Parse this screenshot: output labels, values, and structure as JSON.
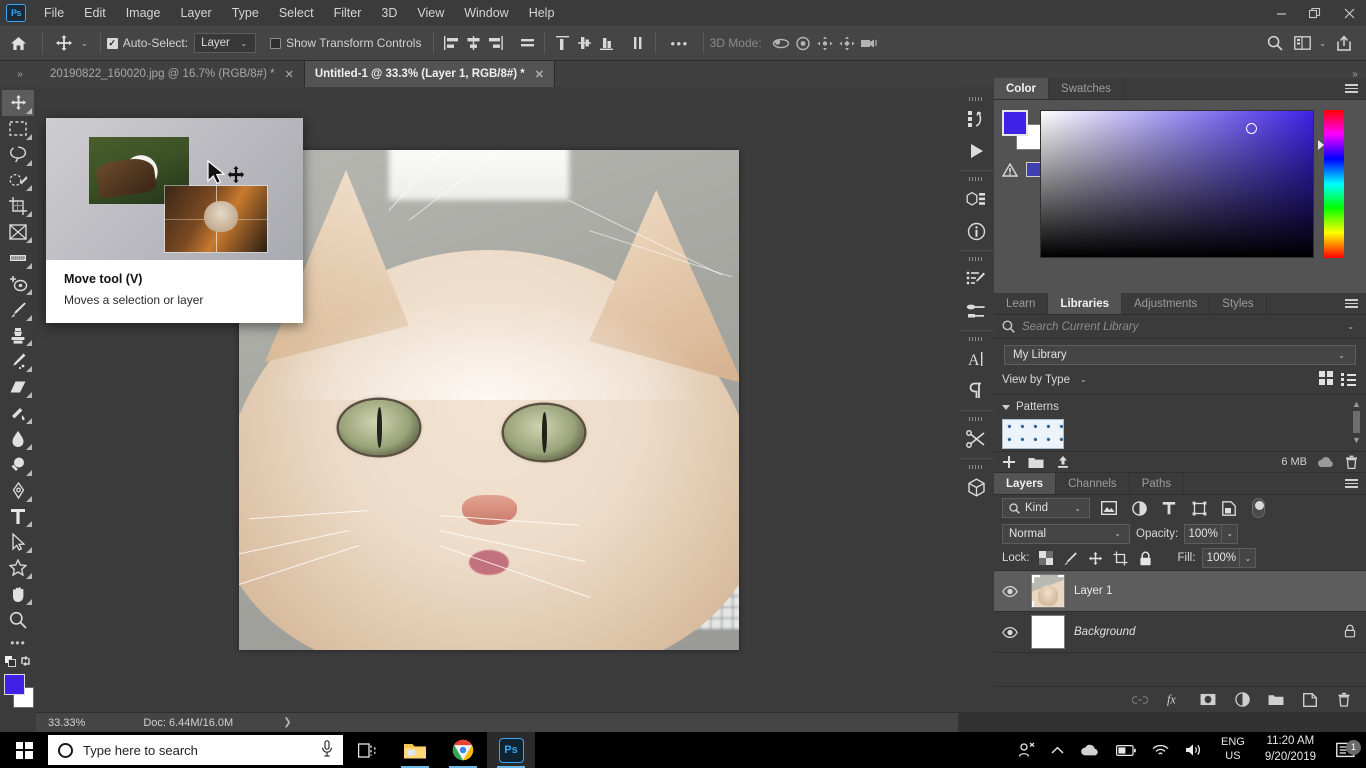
{
  "app": {
    "logo": "Ps",
    "title": "Adobe Photoshop"
  },
  "menubar": {
    "items": [
      "File",
      "Edit",
      "Image",
      "Layer",
      "Type",
      "Select",
      "Filter",
      "3D",
      "View",
      "Window",
      "Help"
    ],
    "window_controls": {
      "minimize": "—",
      "restore": "❐",
      "close": "✕"
    }
  },
  "options_bar": {
    "home_icon": "home-icon",
    "tool_icon": "move-tool-icon",
    "auto_select_label": "Auto-Select:",
    "auto_select_checked": true,
    "auto_select_value": "Layer",
    "show_transform_label": "Show Transform Controls",
    "show_transform_checked": false,
    "more_options": "•••",
    "mode_3d_label": "3D Mode:",
    "align_icons": [
      "align-left-edges",
      "align-horizontal-centers",
      "align-right-edges",
      "distribute-horizontal"
    ],
    "align_icons_2": [
      "align-top-edges",
      "align-vertical-centers",
      "align-bottom-edges",
      "distribute-vertical"
    ],
    "icons_3d": [
      "orbit-3d-icon",
      "roll-3d-icon",
      "pan-3d-icon",
      "slide-3d-icon",
      "camera-3d-icon"
    ],
    "right_icons": [
      "search-icon",
      "workspace-icon",
      "chevron-down-icon",
      "share-icon"
    ]
  },
  "tabs": {
    "collapse_icon": "»",
    "items": [
      {
        "label": "20190822_160020.jpg @ 16.7% (RGB/8#) *",
        "active": false,
        "close": "✕"
      },
      {
        "label": "Untitled-1 @ 33.3% (Layer 1, RGB/8#) *",
        "active": true,
        "close": "✕"
      }
    ],
    "expand_icon": "»"
  },
  "toolbar": {
    "tools": [
      {
        "name": "move-tool",
        "glyph": "✥",
        "selected": true
      },
      {
        "name": "rectangular-marquee-tool",
        "glyph": "▭",
        "selected": false
      },
      {
        "name": "lasso-tool",
        "glyph": "◯",
        "selected": false
      },
      {
        "name": "object-selection-tool",
        "glyph": "✦",
        "selected": false
      },
      {
        "name": "crop-tool",
        "glyph": "⌗",
        "selected": false
      },
      {
        "name": "frame-tool",
        "glyph": "⊠",
        "selected": false
      },
      {
        "name": "eyedropper-tool",
        "glyph": "▨",
        "selected": false
      },
      {
        "name": "spot-healing-brush-tool",
        "glyph": "✜",
        "selected": false
      },
      {
        "name": "brush-tool",
        "glyph": "✎",
        "selected": false
      },
      {
        "name": "clone-stamp-tool",
        "glyph": "⬗",
        "selected": false
      },
      {
        "name": "history-brush-tool",
        "glyph": "✐",
        "selected": false
      },
      {
        "name": "eraser-tool",
        "glyph": "◣",
        "selected": false
      },
      {
        "name": "gradient-tool",
        "glyph": "◨",
        "selected": false
      },
      {
        "name": "blur-tool",
        "glyph": "💧",
        "selected": false
      },
      {
        "name": "dodge-tool",
        "glyph": "🔍",
        "selected": false
      },
      {
        "name": "pen-tool",
        "glyph": "✒",
        "selected": false
      },
      {
        "name": "horizontal-type-tool",
        "glyph": "T",
        "selected": false
      },
      {
        "name": "path-selection-tool",
        "glyph": "➤",
        "selected": false
      },
      {
        "name": "custom-shape-tool",
        "glyph": "✧",
        "selected": false
      },
      {
        "name": "hand-tool",
        "glyph": "✋",
        "selected": false
      },
      {
        "name": "zoom-tool",
        "glyph": "🔎",
        "selected": false
      }
    ],
    "edit_toolbar": "•••",
    "foreground_color": "#3f22e6",
    "background_color": "#ffffff"
  },
  "canvas": {
    "document_label": "Untitled-1",
    "image_alt": "close-up photo of a cream tabby cat"
  },
  "tooltip": {
    "title": "Move tool (V)",
    "description": "Moves a selection or layer",
    "cursor_icon": "move-cursor-icon"
  },
  "statusbar": {
    "zoom": "33.33%",
    "doc": "Doc: 6.44M/16.0M",
    "arrow": "❯"
  },
  "rail": {
    "groups": [
      [
        "history-icon",
        "play-icon"
      ],
      [
        "3d-panel-icon",
        "info-icon"
      ],
      [
        "brush-settings-icon",
        "brush-presets-icon"
      ],
      [
        "character-panel-icon",
        "paragraph-panel-icon"
      ],
      [
        "tools-icon"
      ],
      [
        "3d-object-icon"
      ]
    ]
  },
  "color_panel": {
    "tabs": [
      {
        "label": "Color",
        "active": true
      },
      {
        "label": "Swatches",
        "active": false
      }
    ],
    "menu_icon": "panel-menu-icon",
    "foreground": "#3f22e6",
    "background": "#ffffff",
    "out_of_gamut_icon": "gamut-warning-icon",
    "gamut_swatch": "#3f3fb0"
  },
  "libraries_panel": {
    "tabs": [
      {
        "label": "Learn",
        "active": false
      },
      {
        "label": "Libraries",
        "active": true
      },
      {
        "label": "Adjustments",
        "active": false
      },
      {
        "label": "Styles",
        "active": false
      }
    ],
    "menu_icon": "panel-menu-icon",
    "search_placeholder": "Search Current Library",
    "search_value": "",
    "library_name": "My Library",
    "view_label": "View by Type",
    "group_label": "Patterns",
    "size_label": "6 MB",
    "footer_icons": [
      "add-icon",
      "new-group-icon",
      "upload-icon",
      "cloud-icon",
      "delete-icon"
    ]
  },
  "layers_panel": {
    "tabs": [
      {
        "label": "Layers",
        "active": true
      },
      {
        "label": "Channels",
        "active": false
      },
      {
        "label": "Paths",
        "active": false
      }
    ],
    "menu_icon": "panel-menu-icon",
    "filter_kind": "Kind",
    "filter_icons": [
      "pixel-filter-icon",
      "adjustment-filter-icon",
      "type-filter-icon",
      "shape-filter-icon",
      "smart-object-filter-icon"
    ],
    "blend_mode": "Normal",
    "opacity_label": "Opacity:",
    "opacity_value": "100%",
    "lock_label": "Lock:",
    "lock_icons": [
      "lock-transparent-pixels-icon",
      "lock-image-pixels-icon",
      "lock-position-icon",
      "lock-artboard-icon",
      "lock-all-icon"
    ],
    "fill_label": "Fill:",
    "fill_value": "100%",
    "layers": [
      {
        "name": "Layer 1",
        "visible": true,
        "selected": true,
        "italic": false,
        "locked": false,
        "thumb": "cat"
      },
      {
        "name": "Background",
        "visible": true,
        "selected": false,
        "italic": true,
        "locked": true,
        "thumb": "white"
      }
    ],
    "footer_icons": [
      "link-layers-icon",
      "layer-style-icon",
      "layer-mask-icon",
      "adjustment-layer-icon",
      "new-group-icon",
      "new-layer-icon",
      "delete-layer-icon"
    ]
  },
  "taskbar": {
    "start_icon": "windows-start-icon",
    "search_placeholder": "Type here to search",
    "mic_icon": "microphone-icon",
    "icons": [
      {
        "name": "task-view-icon",
        "running": false
      },
      {
        "name": "file-explorer-icon",
        "running": true
      },
      {
        "name": "google-chrome-icon",
        "running": true
      },
      {
        "name": "photoshop-icon",
        "running": true,
        "active": true
      }
    ],
    "tray": {
      "people_icon": "people-icon",
      "chevron_icon": "show-hidden-icons-icon",
      "onedrive_icon": "onedrive-icon",
      "battery_icon": "battery-icon",
      "wifi_icon": "wifi-icon",
      "volume_icon": "volume-icon",
      "language": "ENG",
      "region": "US",
      "time": "11:20 AM",
      "date": "9/20/2019",
      "notification_icon": "notifications-icon",
      "notification_count": "1"
    }
  }
}
